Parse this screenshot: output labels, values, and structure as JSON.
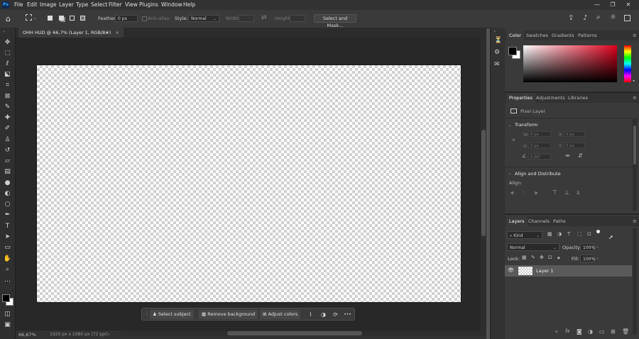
{
  "menubar": {
    "logo": "Ps",
    "items": [
      "File",
      "Edit",
      "Image",
      "Layer",
      "Type",
      "Select",
      "Filter",
      "View",
      "Plugins",
      "Window",
      "Help"
    ],
    "window_controls": [
      "—",
      "❐",
      "✕"
    ]
  },
  "options": {
    "feather_label": "Feather:",
    "feather_value": "0 px",
    "antialias_label": "Anti-alias",
    "style_label": "Style:",
    "style_value": "Normal",
    "width_label": "Width:",
    "height_label": "Height:",
    "select_mask_button": "Select and Mask..."
  },
  "document": {
    "tab_title": "OHH HUD @ 66,7% (Layer 1, RGB/8#)",
    "close": "×"
  },
  "status": {
    "zoom": "66,67%",
    "info": "1920 px x 1080 px (72 ppi)",
    "arrow": "›"
  },
  "contextbar": {
    "select_subject": "Select subject",
    "remove_background": "Remove background",
    "adjust_colors": "Adjust colors",
    "more": "•••"
  },
  "color_panel": {
    "tabs": [
      "Color",
      "Swatches",
      "Gradients",
      "Patterns"
    ],
    "foreground": "#000000",
    "background": "#ffffff"
  },
  "properties_panel": {
    "tabs": [
      "Properties",
      "Adjustments",
      "Libraries"
    ],
    "layer_type": "Pixel Layer",
    "transform_title": "Transform",
    "w_label": "W",
    "w_value": "0 px",
    "h_label": "H",
    "h_value": "0 px",
    "x_label": "X",
    "x_value": "0 px",
    "y_label": "Y",
    "y_value": "0 px",
    "angle_value": "0.00°",
    "align_title": "Align and Distribute",
    "align_label": "Align:"
  },
  "layers_panel": {
    "tabs": [
      "Layers",
      "Channels",
      "Paths"
    ],
    "filter_kind": "Kind",
    "blend_mode": "Normal",
    "opacity_label": "Opacity:",
    "opacity_value": "100%",
    "lock_label": "Lock:",
    "fill_label": "Fill:",
    "fill_value": "100%",
    "layers": [
      {
        "name": "Layer 1",
        "visible": true,
        "selected": true
      }
    ]
  },
  "icons": {
    "tools": [
      "move-icon",
      "marquee-icon",
      "lasso-icon",
      "object-select-icon",
      "crop-icon",
      "frame-icon",
      "eyedropper-icon",
      "healing-icon",
      "brush-icon",
      "stamp-icon",
      "history-brush-icon",
      "eraser-icon",
      "gradient-icon",
      "blur-icon",
      "dodge-icon",
      "pen-icon",
      "type-icon",
      "path-select-icon",
      "shape-icon",
      "hand-icon",
      "zoom-icon",
      "more-tools-icon"
    ]
  }
}
